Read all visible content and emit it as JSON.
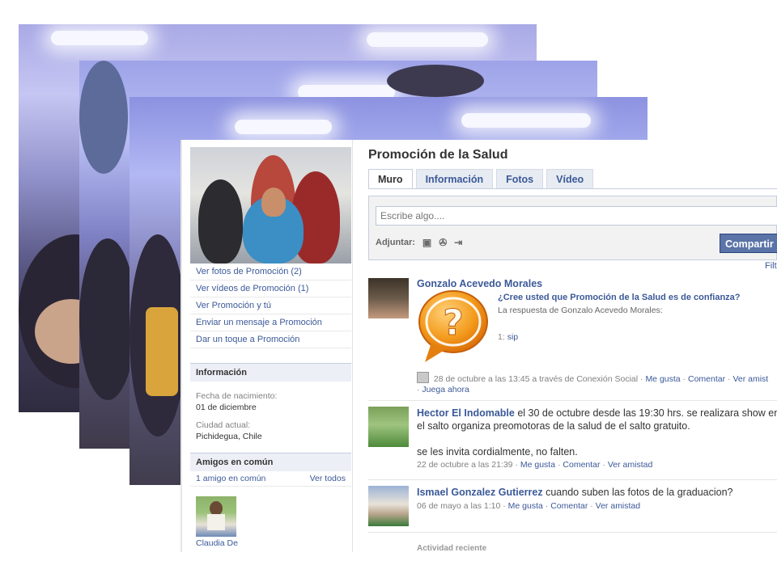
{
  "page": {
    "name": "Promoción de la Salud",
    "tabs": [
      {
        "label": "Muro",
        "active": true
      },
      {
        "label": "Información",
        "active": false
      },
      {
        "label": "Fotos",
        "active": false
      },
      {
        "label": "Vídeo",
        "active": false
      }
    ]
  },
  "sidebar": {
    "links": [
      "Ver fotos de Promoción (2)",
      "Ver vídeos de Promoción (1)",
      "Ver Promoción y tú",
      "Enviar un mensaje a Promoción",
      "Dar un toque a Promoción"
    ],
    "info": {
      "heading": "Información",
      "birth_label": "Fecha de nacimiento:",
      "birth_value": "01 de diciembre",
      "city_label": "Ciudad actual:",
      "city_value": "Pichidegua, Chile"
    },
    "friends": {
      "heading": "Amigos en común",
      "count_label": "1 amigo en común",
      "see_all": "Ver todos",
      "friend_name": "Claudia De"
    }
  },
  "composer": {
    "placeholder": "Escribe algo....",
    "attach_label": "Adjuntar:",
    "share_label": "Compartir",
    "filter_label": "Filt"
  },
  "stories": [
    {
      "author": "Gonzalo Acevedo Morales",
      "question": "¿Cree usted que Promoción de la Salud es de confianza?",
      "answer_intro": "La respuesta de Gonzalo Acevedo Morales:",
      "answer_num": "1:",
      "answer_text": "sip",
      "meta_time": "28 de octubre a las 13:45 a través de Conexión Social",
      "meta_like": "Me gusta",
      "meta_comment": "Comentar",
      "meta_friend": "Ver amist",
      "meta_play": "Juega ahora"
    },
    {
      "author": "Hector El Indomable",
      "text1": " el 30 de octubre desde las 19:30 hrs. se realizara show en el salto organiza preomotoras de la salud de el salto gratuito.",
      "text2": "se les invita cordialmente, no falten.",
      "meta_time": "22 de octubre a las 21:39",
      "meta_like": "Me gusta",
      "meta_comment": "Comentar",
      "meta_friend": "Ver amistad"
    },
    {
      "author": "Ismael Gonzalez Gutierrez",
      "text1": " cuando suben las fotos de la graduacion?",
      "meta_time": "06 de mayo a las 1:10",
      "meta_like": "Me gusta",
      "meta_comment": "Comentar",
      "meta_friend": "Ver amistad"
    }
  ],
  "recent_activity": "Actividad reciente",
  "colors": {
    "link": "#3b5998",
    "share_button": "#5b74a8",
    "tab_bg": "#e7ebf2"
  },
  "icons": [
    "photo-icon",
    "video-icon",
    "link-icon",
    "question-bubble-icon",
    "app-icon"
  ]
}
